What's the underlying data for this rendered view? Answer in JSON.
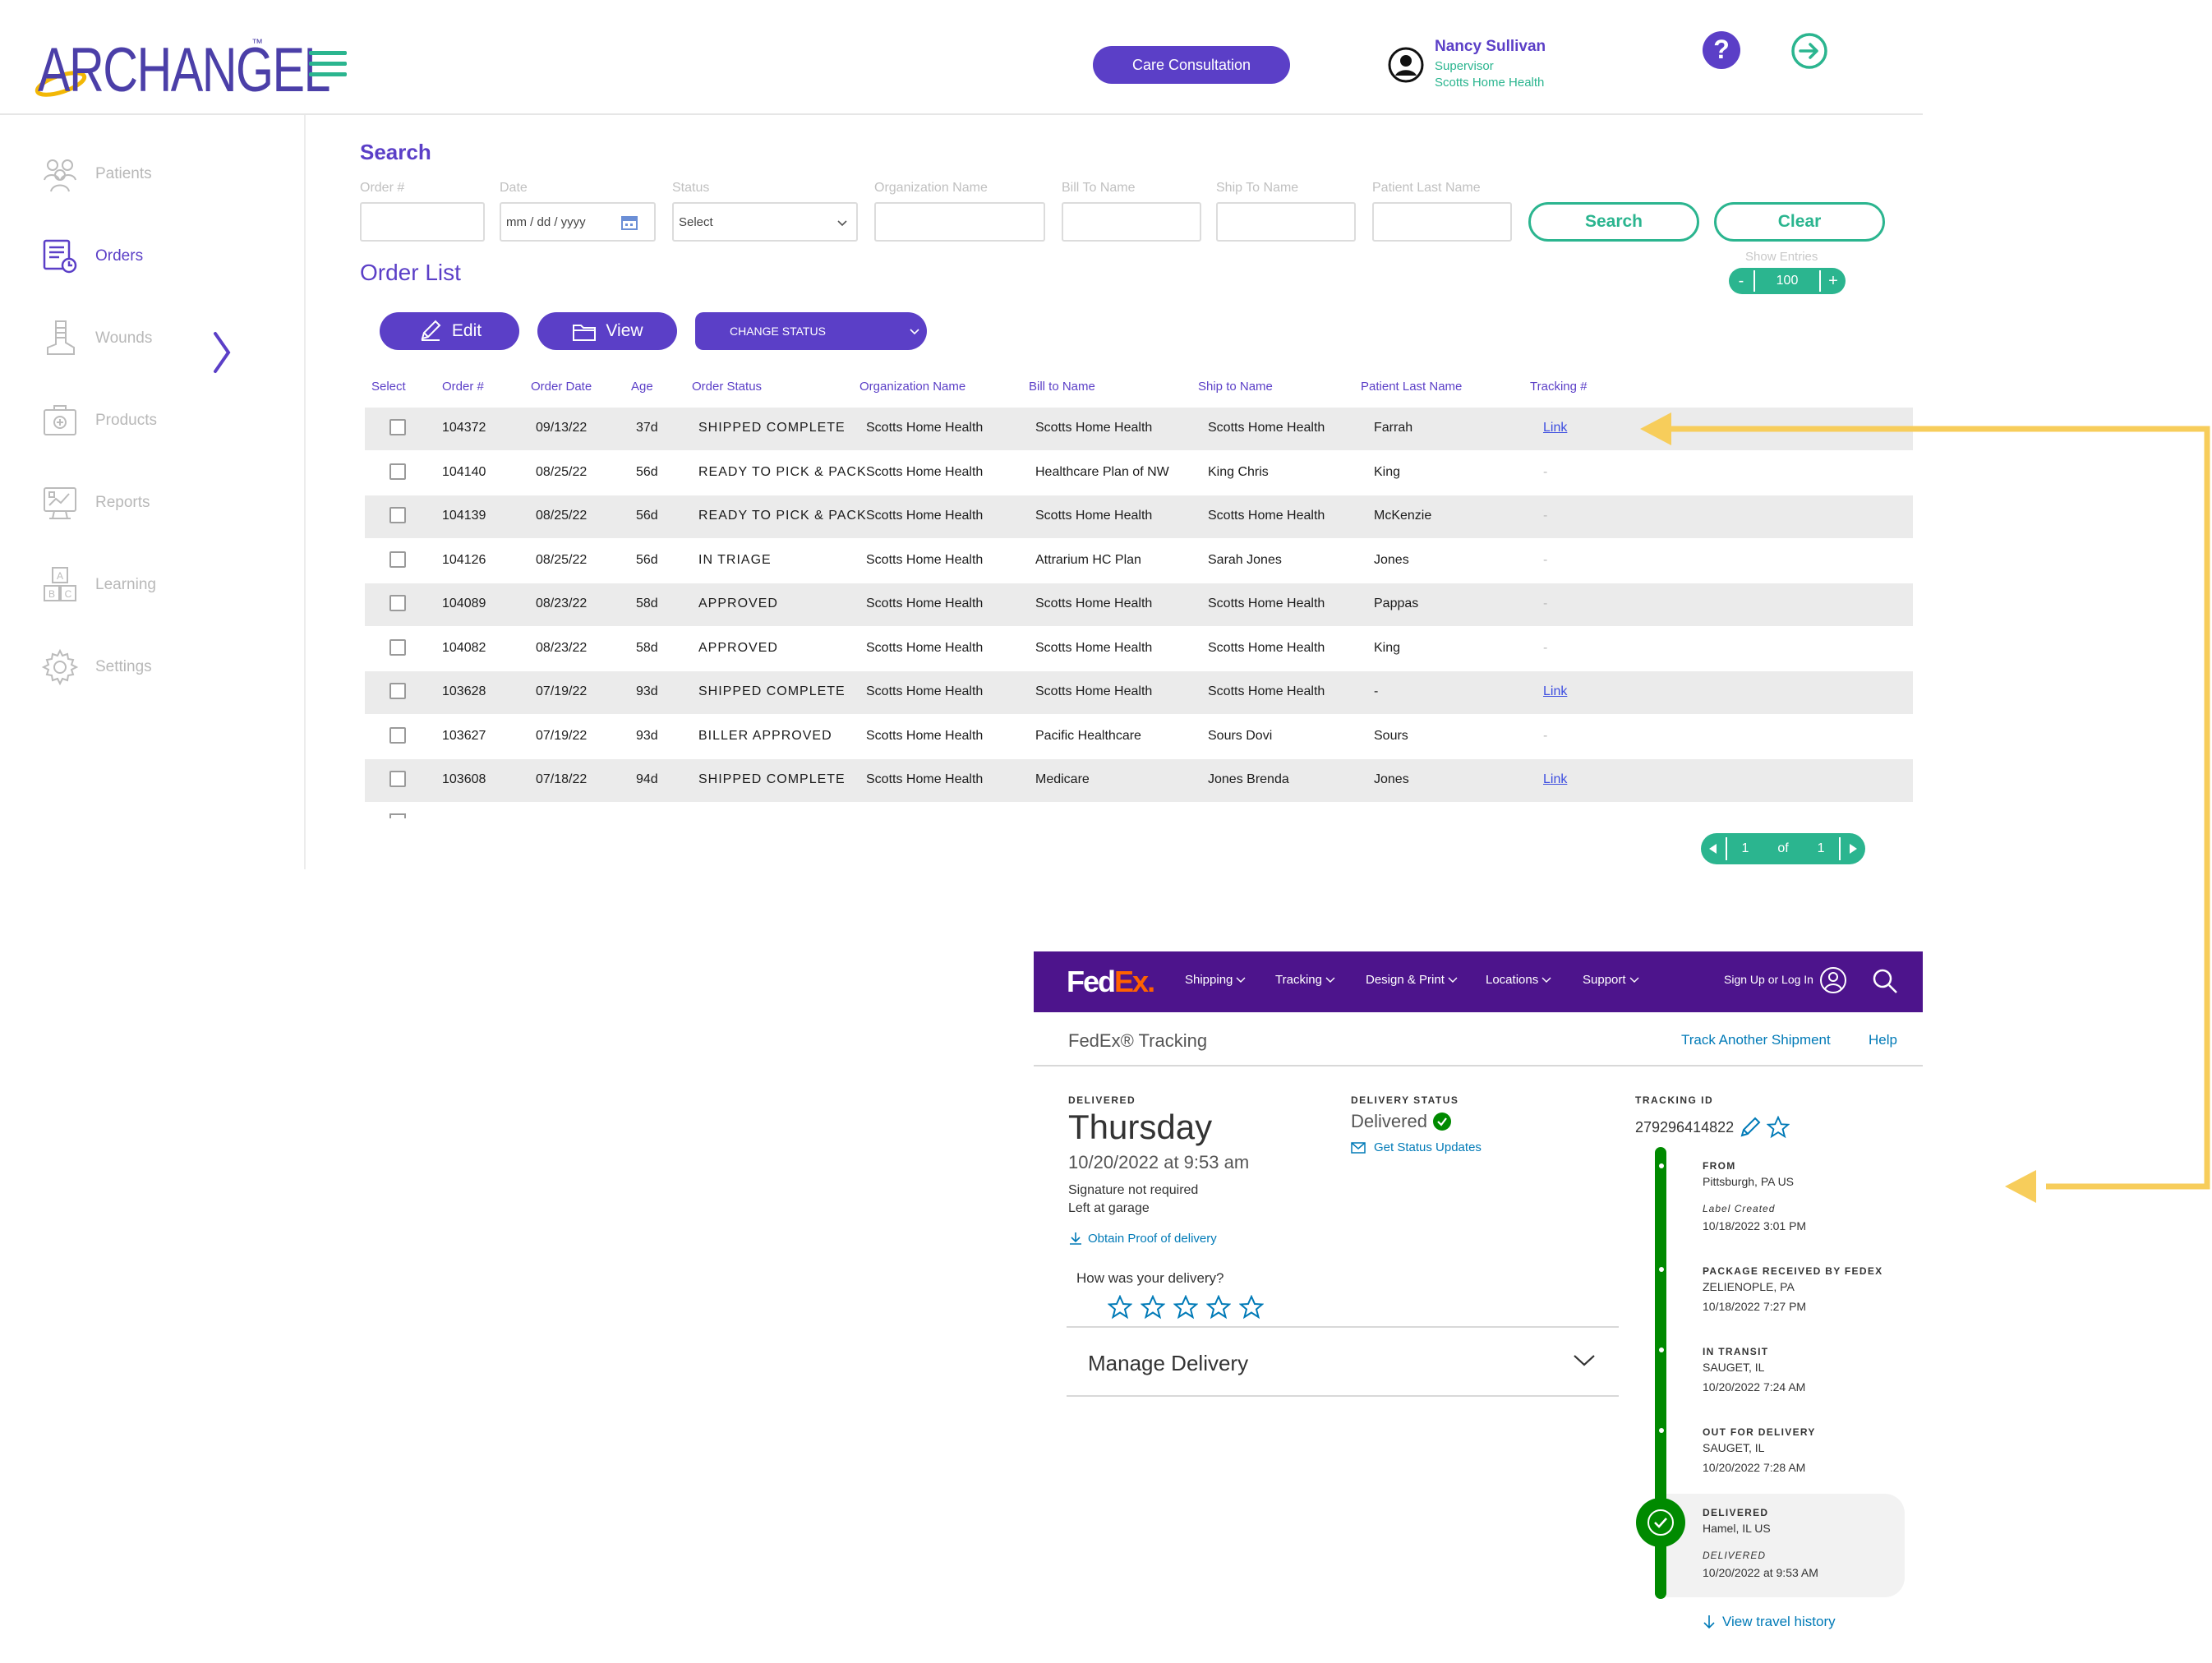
{
  "app": {
    "logo": "ARCHANGEL",
    "logo_tm": "™",
    "header": {
      "consult_button": "Care Consultation",
      "user_name": "Nancy Sullivan",
      "user_role": "Supervisor",
      "user_org": "Scotts Home Health"
    },
    "sidebar": {
      "items": [
        {
          "label": "Patients",
          "icon": "patients-icon"
        },
        {
          "label": "Orders",
          "icon": "orders-icon"
        },
        {
          "label": "Wounds",
          "icon": "wounds-icon"
        },
        {
          "label": "Products",
          "icon": "products-icon"
        },
        {
          "label": "Reports",
          "icon": "reports-icon"
        },
        {
          "label": "Learning",
          "icon": "learning-icon"
        },
        {
          "label": "Settings",
          "icon": "gear-icon"
        }
      ],
      "active": "Orders"
    },
    "search": {
      "title": "Search",
      "labels": {
        "order": "Order #",
        "date": "Date",
        "status": "Status",
        "organization": "Organization Name",
        "bill_to": "Bill To Name",
        "ship_to": "Ship To Name",
        "patient_last": "Patient Last Name"
      },
      "date_placeholder": "mm / dd / yyyy",
      "status_value": "Select",
      "search_button": "Search",
      "clear_button": "Clear",
      "show_entries_label": "Show Entries",
      "entries_minus": "-",
      "entries_value": "100",
      "entries_plus": "+"
    },
    "orders": {
      "title": "Order List",
      "edit_button": "Edit",
      "view_button": "View",
      "change_status_button": "CHANGE STATUS",
      "columns": [
        "Select",
        "Order  #",
        "Order Date",
        "Age",
        "Order Status",
        "Organization Name",
        "Bill to Name",
        "Ship to Name",
        "Patient Last Name",
        "Tracking #"
      ],
      "rows": [
        {
          "order": "104372",
          "date": "09/13/22",
          "age": "37d",
          "status": "SHIPPED COMPLETE",
          "org": "Scotts Home Health",
          "bill": "Scotts Home Health",
          "ship": "Scotts Home Health",
          "patient": "Farrah",
          "tracking": "Link"
        },
        {
          "order": "104140",
          "date": "08/25/22",
          "age": "56d",
          "status": "READY TO PICK & PACK",
          "org": "Scotts Home Health",
          "bill": "Healthcare Plan of NW",
          "ship": "King Chris",
          "patient": "King",
          "tracking": "-"
        },
        {
          "order": "104139",
          "date": "08/25/22",
          "age": "56d",
          "status": "READY TO PICK & PACK",
          "org": "Scotts Home Health",
          "bill": "Scotts Home Health",
          "ship": "Scotts Home Health",
          "patient": "McKenzie",
          "tracking": "-"
        },
        {
          "order": "104126",
          "date": "08/25/22",
          "age": "56d",
          "status": "IN TRIAGE",
          "org": "Scotts Home Health",
          "bill": "Attrarium HC Plan",
          "ship": "Sarah Jones",
          "patient": "Jones",
          "tracking": "-"
        },
        {
          "order": "104089",
          "date": "08/23/22",
          "age": "58d",
          "status": "APPROVED",
          "org": "Scotts Home Health",
          "bill": "Scotts Home Health",
          "ship": "Scotts Home Health",
          "patient": "Pappas",
          "tracking": "-"
        },
        {
          "order": "104082",
          "date": "08/23/22",
          "age": "58d",
          "status": "APPROVED",
          "org": "Scotts Home Health",
          "bill": "Scotts Home Health",
          "ship": "Scotts Home Health",
          "patient": "King",
          "tracking": "-"
        },
        {
          "order": "103628",
          "date": "07/19/22",
          "age": "93d",
          "status": "SHIPPED COMPLETE",
          "org": "Scotts Home Health",
          "bill": "Scotts Home Health",
          "ship": "Scotts Home Health",
          "patient": "-",
          "tracking": "Link"
        },
        {
          "order": "103627",
          "date": "07/19/22",
          "age": "93d",
          "status": "BILLER APPROVED",
          "org": "Scotts Home Health",
          "bill": "Pacific Healthcare",
          "ship": "Sours Dovi",
          "patient": "Sours",
          "tracking": "-"
        },
        {
          "order": "103608",
          "date": "07/18/22",
          "age": "94d",
          "status": "SHIPPED COMPLETE",
          "org": "Scotts Home Health",
          "bill": "Medicare",
          "ship": "Jones Brenda",
          "patient": "Jones",
          "tracking": "Link"
        }
      ],
      "pager": {
        "page": "1",
        "of": "of",
        "total": "1"
      }
    }
  },
  "fedex": {
    "logo_fed": "Fed",
    "logo_ex": "Ex",
    "logo_dot": ".",
    "nav": [
      "Shipping",
      "Tracking",
      "Design & Print",
      "Locations",
      "Support"
    ],
    "sign_in": "Sign Up or Log In",
    "page_title": "FedEx® Tracking",
    "track_another": "Track Another Shipment",
    "help": "Help",
    "delivered_caption": "DELIVERED",
    "day": "Thursday",
    "datetime": "10/20/2022 at 9:53 am",
    "signature": "Signature not required",
    "left_at": "Left at garage",
    "proof_link": "Obtain Proof of delivery",
    "how_was": "How was your delivery?",
    "manage_delivery": "Manage Delivery",
    "status_caption": "DELIVERY STATUS",
    "status_value": "Delivered",
    "get_updates": "Get Status Updates",
    "tracking_caption": "TRACKING ID",
    "tracking_id": "279296414822",
    "steps": [
      {
        "title": "FROM",
        "location": "Pittsburgh, PA US",
        "sub": "Label Created",
        "date": "10/18/2022 3:01 PM"
      },
      {
        "title": "PACKAGE RECEIVED BY FEDEX",
        "location": "ZELIENOPLE, PA",
        "date": "10/18/2022 7:27 PM"
      },
      {
        "title": "IN TRANSIT",
        "location": "SAUGET, IL",
        "date": "10/20/2022 7:24 AM"
      },
      {
        "title": "OUT FOR DELIVERY",
        "location": "SAUGET, IL",
        "date": "10/20/2022 7:28 AM"
      },
      {
        "title": "DELIVERED",
        "location": "Hamel, IL US",
        "sub": "DELIVERED",
        "date": "10/20/2022 at 9:53 AM"
      }
    ],
    "view_history": "View travel history"
  },
  "colors": {
    "archangel_purple": "#5b3fc7",
    "archangel_teal": "#2bb58f",
    "fedex_purple": "#4d148c",
    "fedex_orange": "#ff6200",
    "fedex_green": "#008a00",
    "fedex_link": "#007ab7",
    "arrow_yellow": "#f7cd5b"
  }
}
